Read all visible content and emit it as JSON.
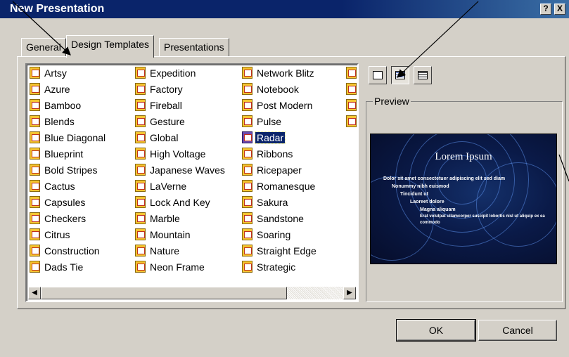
{
  "window": {
    "title": "New Presentation",
    "help_button": "?",
    "close_button": "X"
  },
  "tabs": [
    {
      "label": "General",
      "active": false
    },
    {
      "label": "Design Templates",
      "active": true
    },
    {
      "label": "Presentations",
      "active": false
    }
  ],
  "templates": {
    "column1": [
      "Artsy",
      "Azure",
      "Bamboo",
      "Blends",
      "Blue Diagonal",
      "Blueprint",
      "Bold Stripes",
      "Cactus",
      "Capsules",
      "Checkers",
      "Citrus",
      "Construction",
      "Dads Tie"
    ],
    "column2": [
      "Expedition",
      "Factory",
      "Fireball",
      "Gesture",
      "Global",
      "High Voltage",
      "Japanese Waves",
      "LaVerne",
      "Lock And Key",
      "Marble",
      "Mountain",
      "Nature",
      "Neon Frame"
    ],
    "column3": [
      "Network Blitz",
      "Notebook",
      "Post Modern",
      "Pulse",
      "Radar",
      "Ribbons",
      "Ricepaper",
      "Romanesque",
      "Sakura",
      "Sandstone",
      "Soaring",
      "Straight Edge",
      "Strategic"
    ],
    "selected": "Radar"
  },
  "view_buttons": [
    {
      "icon": "large-icons-view-icon",
      "pressed": false
    },
    {
      "icon": "list-view-icon",
      "pressed": true
    },
    {
      "icon": "details-view-icon",
      "pressed": false
    }
  ],
  "preview": {
    "label": "Preview",
    "slide_title": "Lorem Ipsum",
    "bullets": [
      "Dolor sit amet consectetuer adipiscing elit sed diam",
      "Nonummy nibh euismod",
      "Tincidunt ut",
      "Laoreet dolore",
      "Magna aliquam",
      "Erat volutpat ullamcorper suscipit lobortis nisl ut aliquip ex ea commodo"
    ]
  },
  "buttons": {
    "ok": "OK",
    "cancel": "Cancel"
  },
  "colors": {
    "titlebar": "#0a246a",
    "dialog_bg": "#d4d0c8",
    "selection": "#0a246a"
  }
}
